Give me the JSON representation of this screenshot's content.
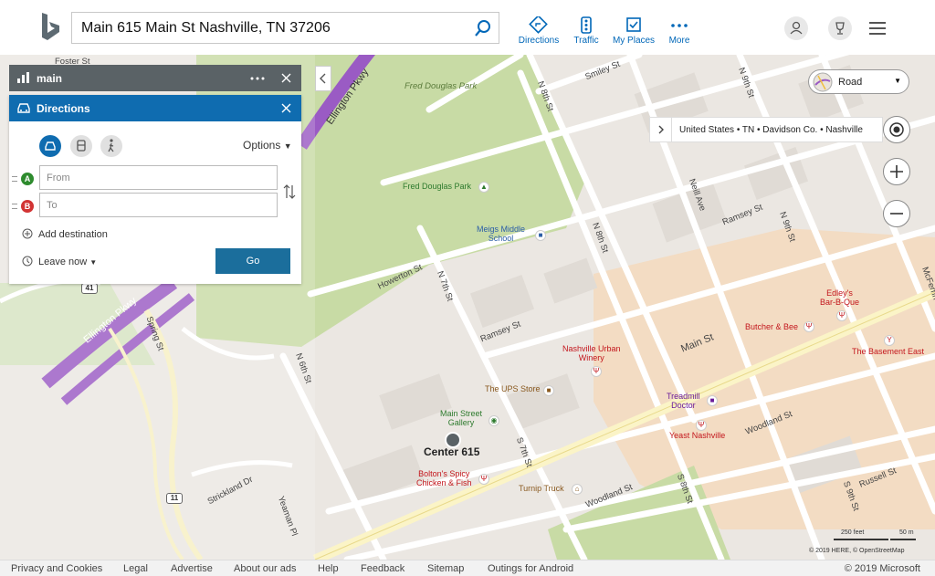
{
  "search": {
    "value": "Main 615 Main St Nashville, TN 37206"
  },
  "topnav": [
    {
      "label": "Directions",
      "icon": "directions-icon"
    },
    {
      "label": "Traffic",
      "icon": "traffic-icon"
    },
    {
      "label": "My Places",
      "icon": "my-places-icon"
    },
    {
      "label": "More",
      "icon": "more-icon"
    }
  ],
  "main_card": {
    "title": "main"
  },
  "directions": {
    "title": "Directions",
    "options_label": "Options",
    "from_placeholder": "From",
    "to_placeholder": "To",
    "pin_a": "A",
    "pin_b": "B",
    "add_destination": "Add destination",
    "leave_now": "Leave now",
    "go": "Go"
  },
  "map_style": {
    "label": "Road"
  },
  "breadcrumb": {
    "text": "United States • TN • Davidson Co. • Nashville"
  },
  "map_labels": {
    "fred_douglas_park_area": "Fred Douglas Park",
    "fred_douglas_park_poi": "Fred Douglas Park",
    "meigs_school": "Meigs Middle\nSchool",
    "nashville_urban_winery": "Nashville Urban\nWinery",
    "butcher_bee": "Butcher & Bee",
    "edleys": "Edley's\nBar-B-Que",
    "basement_east": "The Basement East",
    "ups_store": "The UPS Store",
    "main_street_gallery": "Main Street\nGallery",
    "treadmill_doctor": "Treadmill\nDoctor",
    "yeast_nashville": "Yeast Nashville",
    "center_615": "Center 615",
    "boltons": "Bolton's Spicy\nChicken & Fish",
    "turnip_truck": "Turnip Truck",
    "main_st": "Main St",
    "woodland_st_1": "Woodland St",
    "woodland_st_2": "Woodland St",
    "russell_st": "Russell St",
    "ramsey_st_1": "Ramsey St",
    "ramsey_st_2": "Ramsey St",
    "howerton_st": "Howerton St",
    "n_7th_st": "N 7th St",
    "n_8th_st_1": "N 8th St",
    "n_8th_st_2": "N 8th St",
    "n_9th_st_1": "N 9th St",
    "n_9th_st_2": "N 9th St",
    "n_6th_st": "N 6th St",
    "s_7th_st": "S 7th St",
    "s_8th_st": "S 8th St",
    "s_9th_st": "S 9th St",
    "neill_ave": "Neill Ave",
    "smiley_st": "Smiley St",
    "foster_st": "Foster St",
    "spring_st": "Spring St",
    "strickland_dr": "Strickland Dr",
    "yeaman_pl": "Yeaman Pl",
    "ellington_pkwy_1": "Ellington Pkwy",
    "ellington_pkwy_2": "Ellington Pkwy",
    "mcferrin": "McFerrin",
    "route_41": "41",
    "route_11": "11"
  },
  "scale": {
    "feet": "250 feet",
    "meters": "50 m"
  },
  "map_copyright": "© 2019 HERE, © OpenStreetMap",
  "footer": {
    "links": [
      "Privacy and Cookies",
      "Legal",
      "Advertise",
      "About our ads",
      "Help",
      "Feedback",
      "Sitemap",
      "Outings for Android"
    ],
    "copyright": "© 2019 Microsoft"
  },
  "colors": {
    "accent": "#0f6cb0",
    "park": "#c8dba5",
    "highway": "#9a5bc4",
    "commercial": "#f3dcc3"
  }
}
